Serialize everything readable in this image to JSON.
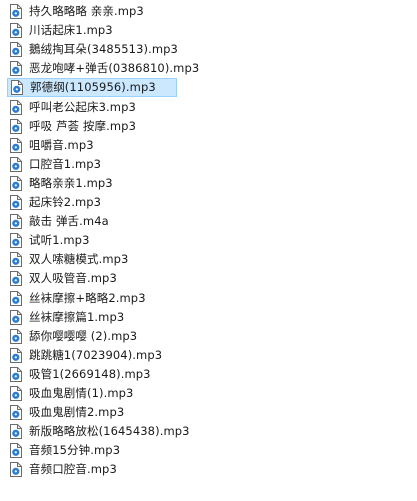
{
  "window": {
    "view": "file-list"
  },
  "colors": {
    "selection_bg": "#cce8ff",
    "selection_border": "#99d1ff",
    "icon_blue": "#2b7cd3"
  },
  "files": [
    {
      "name": "持久略略略 亲亲.mp3",
      "icon": "audio-file-icon",
      "selected": false
    },
    {
      "name": "川话起床1.mp3",
      "icon": "audio-file-icon",
      "selected": false
    },
    {
      "name": "鵝绒掏耳朵(3485513).mp3",
      "icon": "audio-file-icon",
      "selected": false
    },
    {
      "name": "恶龙咆哮+弹舌(0386810).mp3",
      "icon": "audio-file-icon",
      "selected": false
    },
    {
      "name": "郭德纲(1105956).mp3",
      "icon": "audio-file-icon",
      "selected": true
    },
    {
      "name": "呼叫老公起床3.mp3",
      "icon": "audio-file-icon",
      "selected": false
    },
    {
      "name": "呼吸 芦荟 按摩.mp3",
      "icon": "audio-file-icon",
      "selected": false
    },
    {
      "name": "咀嚼音.mp3",
      "icon": "audio-file-icon",
      "selected": false
    },
    {
      "name": "口腔音1.mp3",
      "icon": "audio-file-icon",
      "selected": false
    },
    {
      "name": "略略亲亲1.mp3",
      "icon": "audio-file-icon",
      "selected": false
    },
    {
      "name": "起床铃2.mp3",
      "icon": "audio-file-icon",
      "selected": false
    },
    {
      "name": "敲击 弹舌.m4a",
      "icon": "audio-file-icon",
      "selected": false
    },
    {
      "name": "试听1.mp3",
      "icon": "audio-file-icon",
      "selected": false
    },
    {
      "name": "双人嗦糖模式.mp3",
      "icon": "audio-file-icon",
      "selected": false
    },
    {
      "name": "双人吸管音.mp3",
      "icon": "audio-file-icon",
      "selected": false
    },
    {
      "name": "丝袜摩擦+略略2.mp3",
      "icon": "audio-file-icon",
      "selected": false
    },
    {
      "name": "丝袜摩擦篇1.mp3",
      "icon": "audio-file-icon",
      "selected": false
    },
    {
      "name": "舔你嘤嘤嘤 (2).mp3",
      "icon": "audio-file-icon",
      "selected": false
    },
    {
      "name": "跳跳糖1(7023904).mp3",
      "icon": "audio-file-icon",
      "selected": false
    },
    {
      "name": "吸管1(2669148).mp3",
      "icon": "audio-file-icon",
      "selected": false
    },
    {
      "name": "吸血鬼剧情(1).mp3",
      "icon": "audio-file-icon",
      "selected": false
    },
    {
      "name": "吸血鬼剧情2.mp3",
      "icon": "audio-file-icon",
      "selected": false
    },
    {
      "name": "新版略略放松(1645438).mp3",
      "icon": "audio-file-icon",
      "selected": false
    },
    {
      "name": "音频15分钟.mp3",
      "icon": "audio-file-icon",
      "selected": false
    },
    {
      "name": "音频口腔音.mp3",
      "icon": "audio-file-icon",
      "selected": false
    }
  ]
}
